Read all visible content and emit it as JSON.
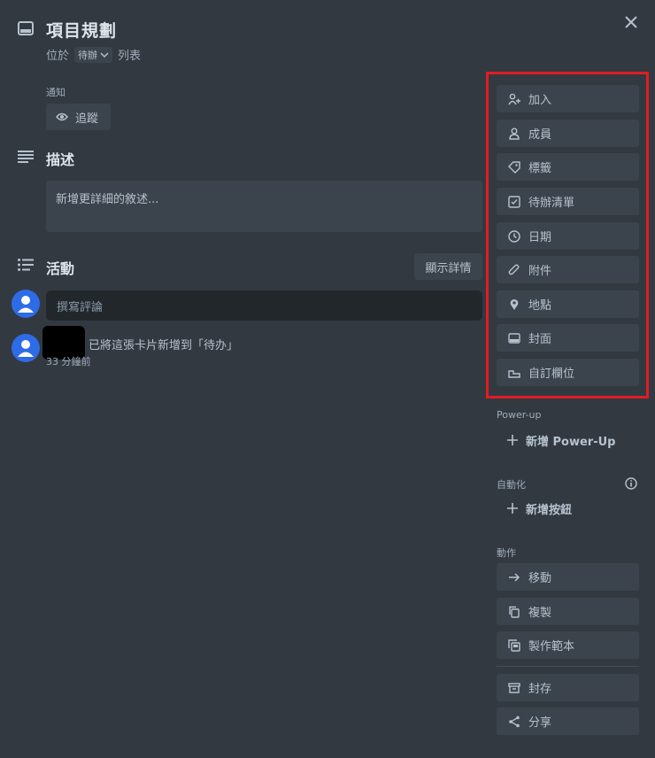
{
  "card": {
    "title": "項目規劃",
    "list_prefix": "位於",
    "list_name": "待辦",
    "list_suffix": "列表"
  },
  "notifications": {
    "label": "通知",
    "watch_label": "追蹤"
  },
  "description": {
    "heading": "描述",
    "placeholder": "新增更詳細的敘述..."
  },
  "activity": {
    "heading": "活動",
    "details_button": "顯示詳情",
    "comment_placeholder": "撰寫評論",
    "entries": [
      {
        "text": "已將這張卡片新增到「待办」",
        "time": "33 分鐘前"
      }
    ]
  },
  "sidebar": {
    "add_to_card": [
      {
        "label": "加入",
        "icon": "add-member-icon"
      },
      {
        "label": "成員",
        "icon": "member-icon"
      },
      {
        "label": "標籤",
        "icon": "label-icon"
      },
      {
        "label": "待辦清單",
        "icon": "checklist-icon"
      },
      {
        "label": "日期",
        "icon": "clock-icon"
      },
      {
        "label": "附件",
        "icon": "paperclip-icon"
      },
      {
        "label": "地點",
        "icon": "location-pin-icon"
      },
      {
        "label": "封面",
        "icon": "cover-icon"
      },
      {
        "label": "自訂欄位",
        "icon": "custom-field-icon"
      }
    ],
    "powerup": {
      "label": "Power-up",
      "add_label": "新增 Power-Up"
    },
    "automation": {
      "label": "自動化",
      "add_label": "新增按鈕"
    },
    "actions": {
      "label": "動作",
      "items": [
        {
          "label": "移動",
          "icon": "arrow-right-icon"
        },
        {
          "label": "複製",
          "icon": "copy-icon"
        },
        {
          "label": "製作範本",
          "icon": "template-icon"
        },
        {
          "label": "封存",
          "icon": "archive-icon"
        },
        {
          "label": "分享",
          "icon": "share-icon"
        }
      ]
    }
  },
  "colors": {
    "background": "#323940",
    "button": "#3b444c",
    "highlight": "#e31b23",
    "avatar": "#2e6be6"
  }
}
